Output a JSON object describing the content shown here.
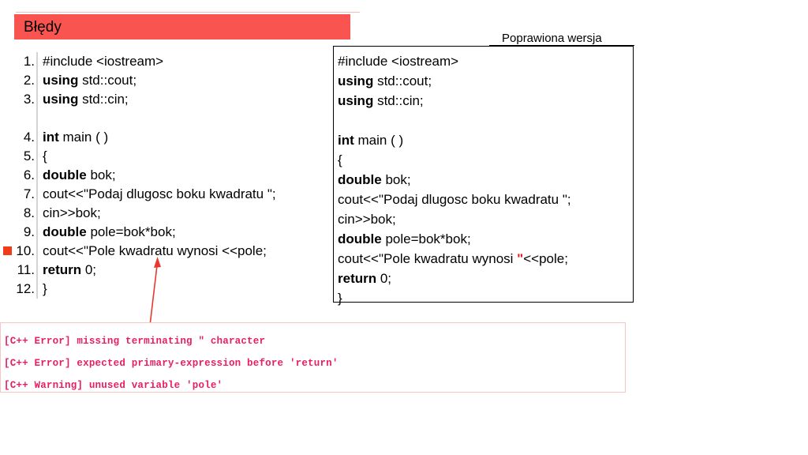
{
  "slide": {
    "title": "Błędy",
    "banner_color": "#fa5450"
  },
  "left_listing": {
    "name": "buggy-code-listing",
    "error_marker_line": 10,
    "marker_color": "#f03c18",
    "lines": [
      {
        "num": "1.",
        "pre": "",
        "kw": "",
        "post": "#include <iostream>"
      },
      {
        "num": "2.",
        "pre": "",
        "kw": "using",
        "post": " std::cout;"
      },
      {
        "num": "3.",
        "pre": "",
        "kw": "using",
        "post": " std::cin;"
      },
      {
        "num": "",
        "pre": "",
        "kw": "",
        "post": ""
      },
      {
        "num": "4.",
        "pre": "",
        "kw": "int",
        "post": " main ( )"
      },
      {
        "num": "5.",
        "pre": "",
        "kw": "",
        "post": "{"
      },
      {
        "num": "6.",
        "pre": "",
        "kw": "double",
        "post": " bok;"
      },
      {
        "num": "7.",
        "pre": "",
        "kw": "",
        "post": "cout<<\"Podaj dlugosc boku kwadratu \";"
      },
      {
        "num": "8.",
        "pre": "",
        "kw": "",
        "post": "cin>>bok;"
      },
      {
        "num": "9.",
        "pre": "",
        "kw": "double",
        "post": " pole=bok*bok;"
      },
      {
        "num": "10.",
        "pre": "",
        "kw": "",
        "post": "cout<<\"Pole kwadratu wynosi <<pole;"
      },
      {
        "num": "11.",
        "pre": "",
        "kw": "return",
        "post": " 0;"
      },
      {
        "num": "12.",
        "pre": "",
        "kw": "",
        "post": "}"
      }
    ]
  },
  "right_panel": {
    "heading": "Poprawiona wersja",
    "fixed_char": "\"",
    "fixed_char_color": "#e8191e",
    "lines": [
      {
        "kw": "",
        "post": "#include <iostream>",
        "fix": "",
        "tail": ""
      },
      {
        "kw": "using",
        "post": " std::cout;",
        "fix": "",
        "tail": ""
      },
      {
        "kw": "using",
        "post": " std::cin;",
        "fix": "",
        "tail": ""
      },
      {
        "kw": "",
        "post": "",
        "fix": "",
        "tail": ""
      },
      {
        "kw": "int",
        "post": " main ( )",
        "fix": "",
        "tail": ""
      },
      {
        "kw": "",
        "post": "{",
        "fix": "",
        "tail": ""
      },
      {
        "kw": "double",
        "post": " bok;",
        "fix": "",
        "tail": ""
      },
      {
        "kw": "",
        "post": "cout<<\"Podaj dlugosc boku kwadratu \";",
        "fix": "",
        "tail": ""
      },
      {
        "kw": "",
        "post": "cin>>bok;",
        "fix": "",
        "tail": ""
      },
      {
        "kw": "double",
        "post": " pole=bok*bok;",
        "fix": "",
        "tail": ""
      },
      {
        "kw": "",
        "post": "cout<<\"Pole kwadratu wynosi ",
        "fix": "\"",
        "tail": "<<pole;"
      },
      {
        "kw": "return",
        "post": " 0;",
        "fix": "",
        "tail": ""
      },
      {
        "kw": "",
        "post": "}",
        "fix": "",
        "tail": ""
      }
    ]
  },
  "error_box": {
    "border_color": "#f7c6c4",
    "text_color": "#e81e63",
    "messages": [
      "[C++ Error] missing terminating \" character",
      "[C++ Error] expected primary-expression before 'return'",
      "[C++ Warning] unused variable 'pole'"
    ]
  },
  "annotation": {
    "arrow_color": "#e8392e",
    "points_to": "line-10"
  }
}
